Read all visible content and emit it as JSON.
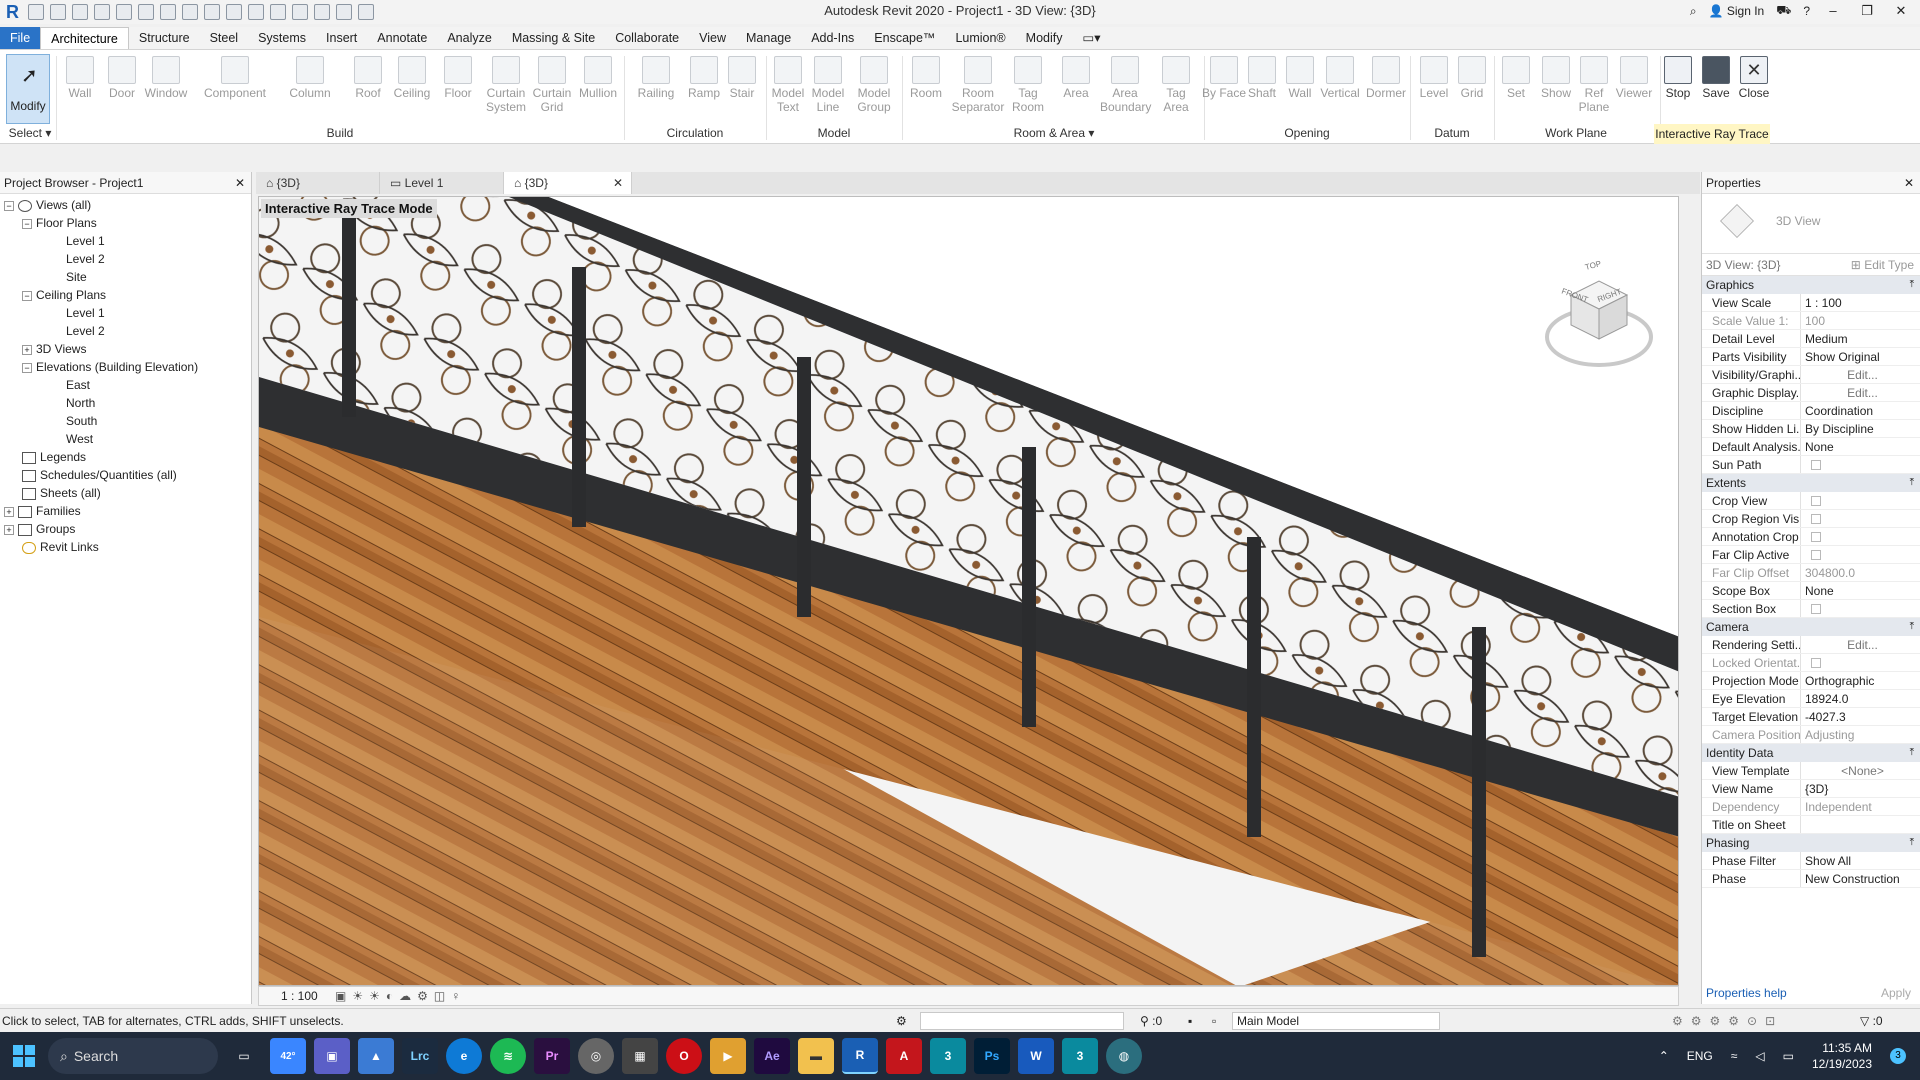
{
  "title": {
    "app_title": "Autodesk Revit 2020 - Project1 - 3D View: {3D}",
    "sign_in": "Sign In"
  },
  "ribbon_tabs": [
    "File",
    "Architecture",
    "Structure",
    "Steel",
    "Systems",
    "Insert",
    "Annotate",
    "Analyze",
    "Massing & Site",
    "Collaborate",
    "View",
    "Manage",
    "Add-Ins",
    "Enscape™",
    "Lumion®",
    "Modify"
  ],
  "ribbon": {
    "modify_label": "Modify",
    "select_label": "Select",
    "buttons": [
      "Wall",
      "Door",
      "Window",
      "Component",
      "Column",
      "Roof",
      "Ceiling",
      "Floor",
      "Curtain System",
      "Curtain Grid",
      "Mullion",
      "Railing",
      "Ramp",
      "Stair",
      "Model Text",
      "Model Line",
      "Model Group",
      "Room",
      "Room Separator",
      "Tag Room",
      "Area",
      "Area Boundary",
      "Tag Area",
      "By Face",
      "Shaft",
      "Wall",
      "Vertical",
      "Dormer",
      "Level",
      "Grid",
      "Set",
      "Show",
      "Ref Plane",
      "Viewer",
      "Stop",
      "Save",
      "Close"
    ],
    "panels": [
      "Build",
      "Circulation",
      "Model",
      "Room & Area",
      "Opening",
      "Datum",
      "Work Plane",
      "Interactive Ray Trace"
    ]
  },
  "browser": {
    "title": "Project Browser - Project1",
    "items": [
      {
        "label": "Views (all)",
        "level": 0
      },
      {
        "label": "Floor Plans",
        "level": 1
      },
      {
        "label": "Level 1",
        "level": 2
      },
      {
        "label": "Level 2",
        "level": 2
      },
      {
        "label": "Site",
        "level": 2
      },
      {
        "label": "Ceiling Plans",
        "level": 1
      },
      {
        "label": "Level 1",
        "level": 2
      },
      {
        "label": "Level 2",
        "level": 2
      },
      {
        "label": "3D Views",
        "level": 1
      },
      {
        "label": "Elevations (Building Elevation)",
        "level": 1
      },
      {
        "label": "East",
        "level": 2
      },
      {
        "label": "North",
        "level": 2
      },
      {
        "label": "South",
        "level": 2
      },
      {
        "label": "West",
        "level": 2
      },
      {
        "label": "Legends",
        "level": 0
      },
      {
        "label": "Schedules/Quantities (all)",
        "level": 0
      },
      {
        "label": "Sheets (all)",
        "level": 0
      },
      {
        "label": "Families",
        "level": 0
      },
      {
        "label": "Groups",
        "level": 0
      },
      {
        "label": "Revit Links",
        "level": 0
      }
    ]
  },
  "view_tabs": [
    "{3D}",
    "Level 1",
    "{3D}"
  ],
  "canvas": {
    "mode_label": "Interactive Ray Trace Mode",
    "viewcube": [
      "TOP",
      "FRONT",
      "RIGHT"
    ],
    "scale": "1 : 100"
  },
  "properties": {
    "title": "Properties",
    "type_name": "3D View",
    "selector": "3D View: {3D}",
    "edit_type": "Edit Type",
    "sections": [
      {
        "name": "Graphics",
        "rows": [
          [
            "View Scale",
            "1 : 100"
          ],
          [
            "Scale Value    1:",
            "100"
          ],
          [
            "Detail Level",
            "Medium"
          ],
          [
            "Parts Visibility",
            "Show Original"
          ],
          [
            "Visibility/Graphi...",
            "Edit..."
          ],
          [
            "Graphic Display...",
            "Edit..."
          ],
          [
            "Discipline",
            "Coordination"
          ],
          [
            "Show Hidden Li...",
            "By Discipline"
          ],
          [
            "Default Analysis...",
            "None"
          ],
          [
            "Sun Path",
            ""
          ]
        ]
      },
      {
        "name": "Extents",
        "rows": [
          [
            "Crop View",
            ""
          ],
          [
            "Crop Region Vis...",
            ""
          ],
          [
            "Annotation Crop",
            ""
          ],
          [
            "Far Clip Active",
            ""
          ],
          [
            "Far Clip Offset",
            "304800.0"
          ],
          [
            "Scope Box",
            "None"
          ],
          [
            "Section Box",
            ""
          ]
        ]
      },
      {
        "name": "Camera",
        "rows": [
          [
            "Rendering Setti...",
            "Edit..."
          ],
          [
            "Locked Orientat...",
            ""
          ],
          [
            "Projection Mode",
            "Orthographic"
          ],
          [
            "Eye Elevation",
            "18924.0"
          ],
          [
            "Target Elevation",
            "-4027.3"
          ],
          [
            "Camera Position",
            "Adjusting"
          ]
        ]
      },
      {
        "name": "Identity Data",
        "rows": [
          [
            "View Template",
            "<None>"
          ],
          [
            "View Name",
            "{3D}"
          ],
          [
            "Dependency",
            "Independent"
          ],
          [
            "Title on Sheet",
            ""
          ]
        ]
      },
      {
        "name": "Phasing",
        "rows": [
          [
            "Phase Filter",
            "Show All"
          ],
          [
            "Phase",
            "New Construction"
          ]
        ]
      }
    ],
    "help": "Properties help",
    "apply": "Apply"
  },
  "status": {
    "hint": "Click to select, TAB for alternates, CTRL adds, SHIFT unselects.",
    "filter_count": ":0",
    "model": "Main Model",
    "selection_count": ":0"
  },
  "taskbar": {
    "search": "Search",
    "weather": "42°",
    "lang": "ENG",
    "time": "11:35 AM",
    "date": "12/19/2023",
    "notifications": "3",
    "apps": [
      "Lrc",
      "Pr",
      "Ae",
      "R",
      "A",
      "3",
      "Ps",
      "W",
      "3"
    ]
  }
}
